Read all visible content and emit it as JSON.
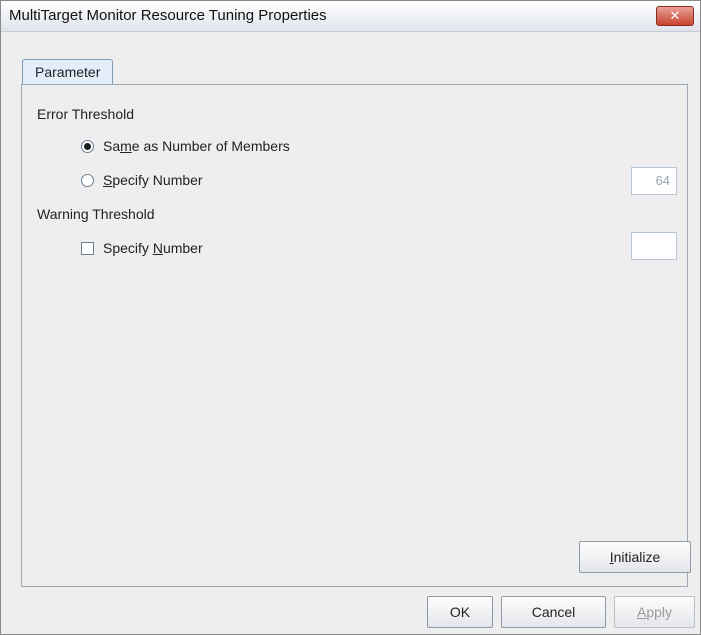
{
  "window": {
    "title": "MultiTarget Monitor Resource Tuning Properties",
    "close_icon": "close-icon"
  },
  "tabs": [
    {
      "label": "Parameter",
      "active": true
    }
  ],
  "error_threshold": {
    "heading": "Error Threshold",
    "option_same": {
      "label_pre": "Sa",
      "mnemonic": "m",
      "label_post": "e as Number of Members",
      "selected": true
    },
    "option_specify": {
      "label_pre": "",
      "mnemonic": "S",
      "label_post": "pecify Number",
      "selected": false
    },
    "value": "64"
  },
  "warning_threshold": {
    "heading": "Warning Threshold",
    "checkbox": {
      "label_pre": "Specify ",
      "mnemonic": "N",
      "label_post": "umber",
      "checked": false
    },
    "value": ""
  },
  "buttons": {
    "initialize": {
      "mnemonic": "I",
      "rest": "nitialize"
    },
    "ok": "OK",
    "cancel": "Cancel",
    "apply": {
      "mnemonic": "A",
      "rest": "pply",
      "enabled": false
    }
  }
}
